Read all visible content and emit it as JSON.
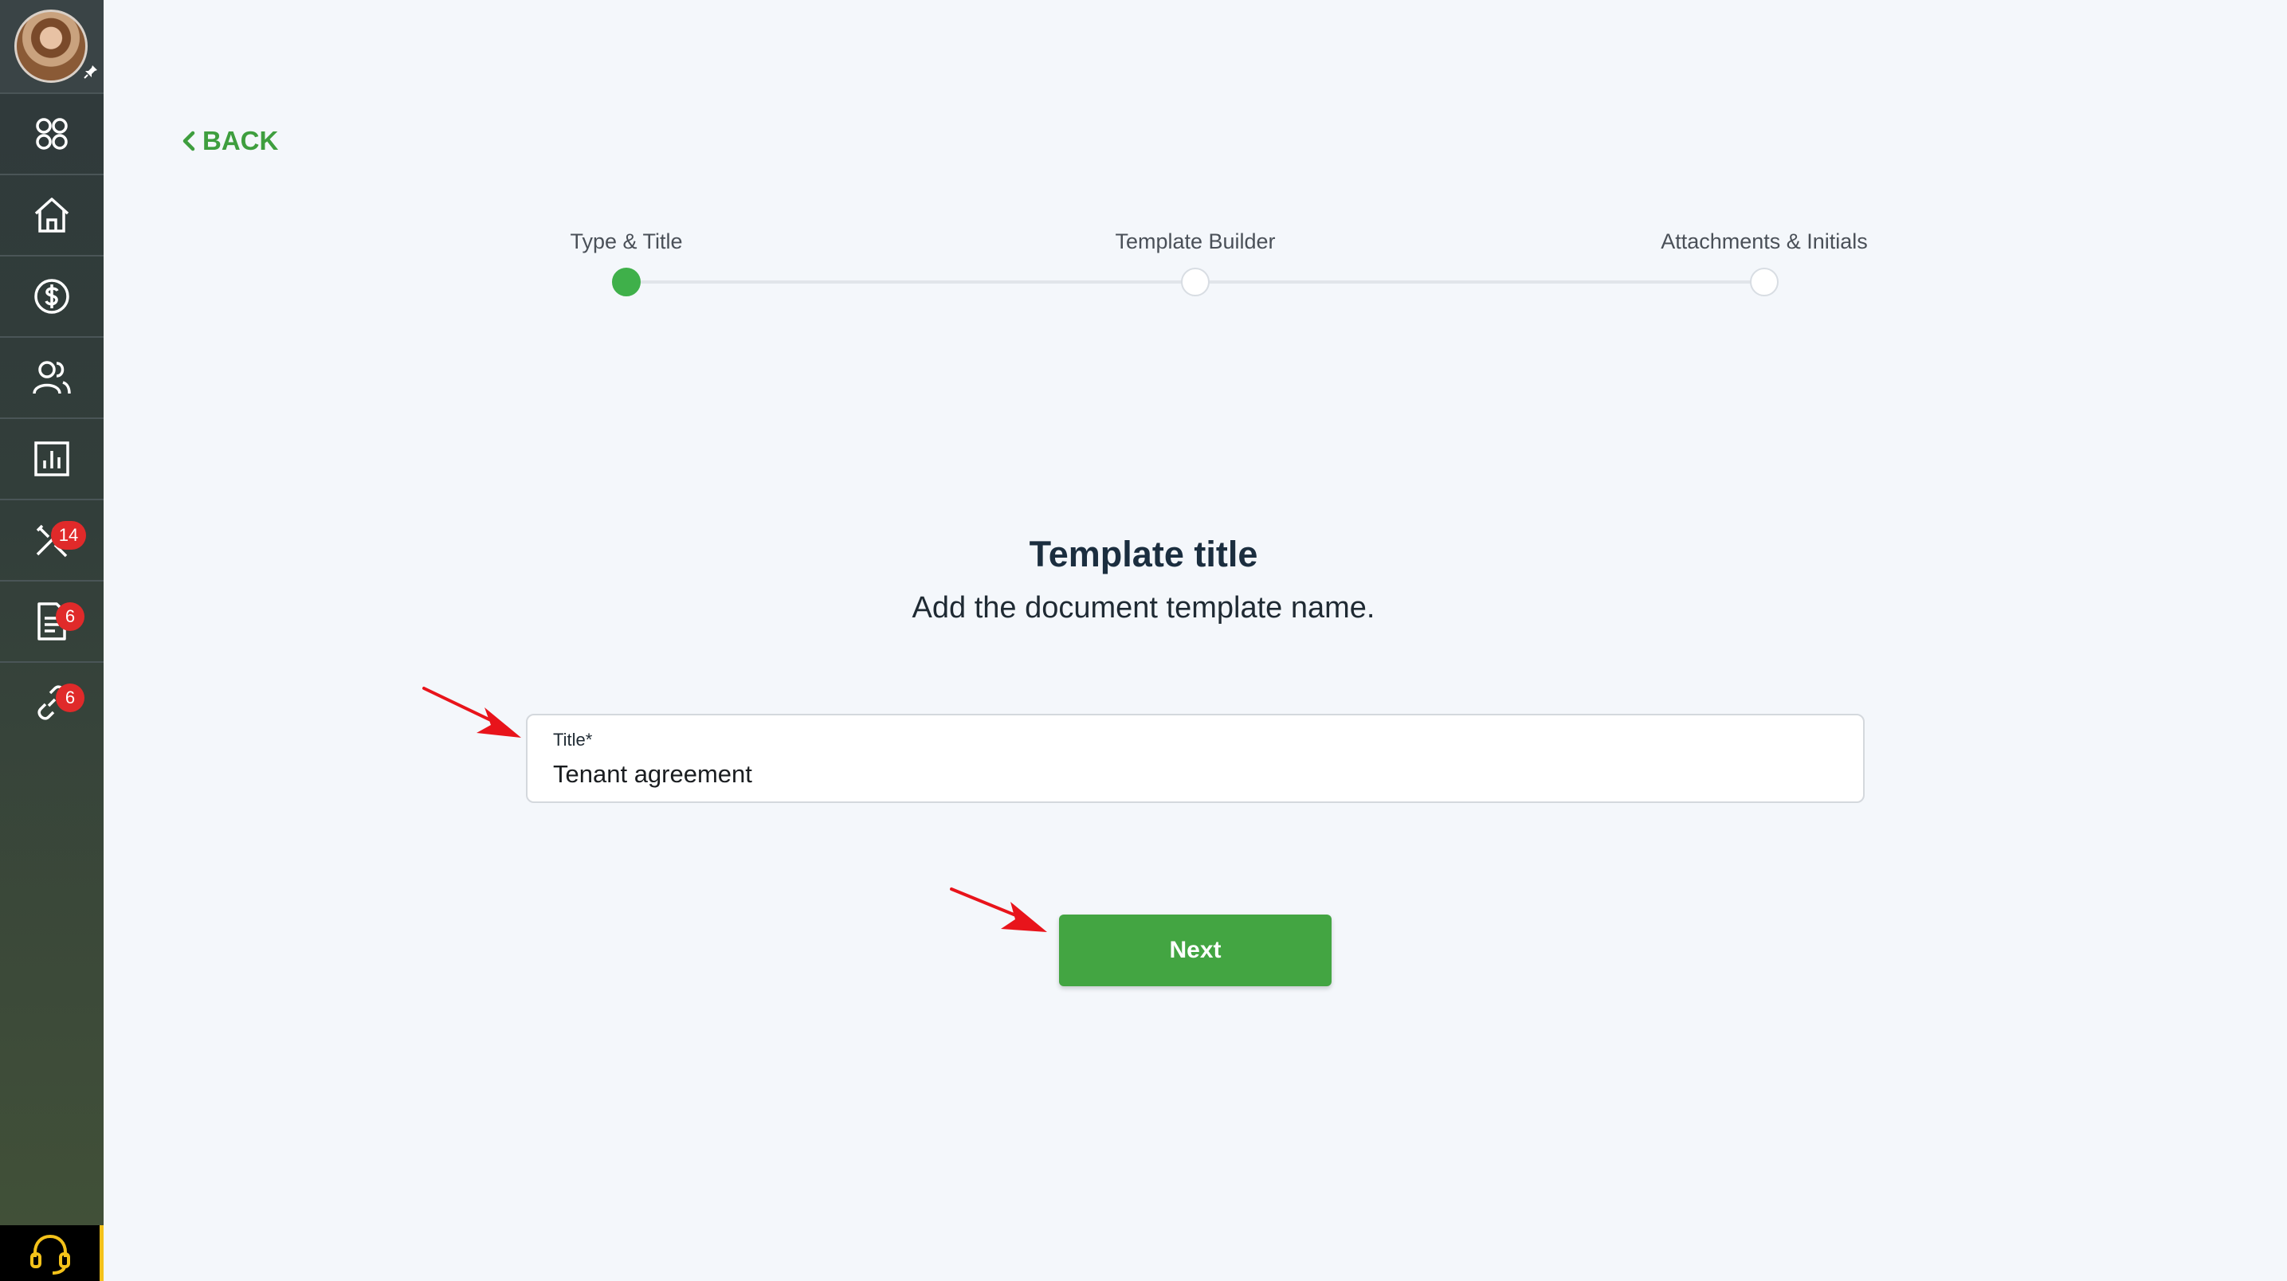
{
  "sidebar": {
    "items": [
      {
        "icon": "apps-grid-icon"
      },
      {
        "icon": "home-icon"
      },
      {
        "icon": "dollar-icon"
      },
      {
        "icon": "people-icon"
      },
      {
        "icon": "reports-icon"
      },
      {
        "icon": "tools-icon",
        "badge": "14"
      },
      {
        "icon": "document-icon",
        "badge": "6"
      },
      {
        "icon": "link-icon",
        "badge": "6"
      }
    ],
    "support_icon": "headset-icon"
  },
  "back": {
    "label": "BACK"
  },
  "stepper": {
    "steps": [
      {
        "label": "Type & Title",
        "state": "active"
      },
      {
        "label": "Template Builder",
        "state": "pending"
      },
      {
        "label": "Attachments & Initials",
        "state": "pending"
      }
    ]
  },
  "main": {
    "title": "Template title",
    "subtitle": "Add the document template name."
  },
  "form": {
    "title_label": "Title*",
    "title_value": "Tenant agreement"
  },
  "actions": {
    "next_label": "Next"
  },
  "colors": {
    "accent": "#43a542",
    "badge": "#e02a2a",
    "annotation_arrow": "#e8141b"
  }
}
